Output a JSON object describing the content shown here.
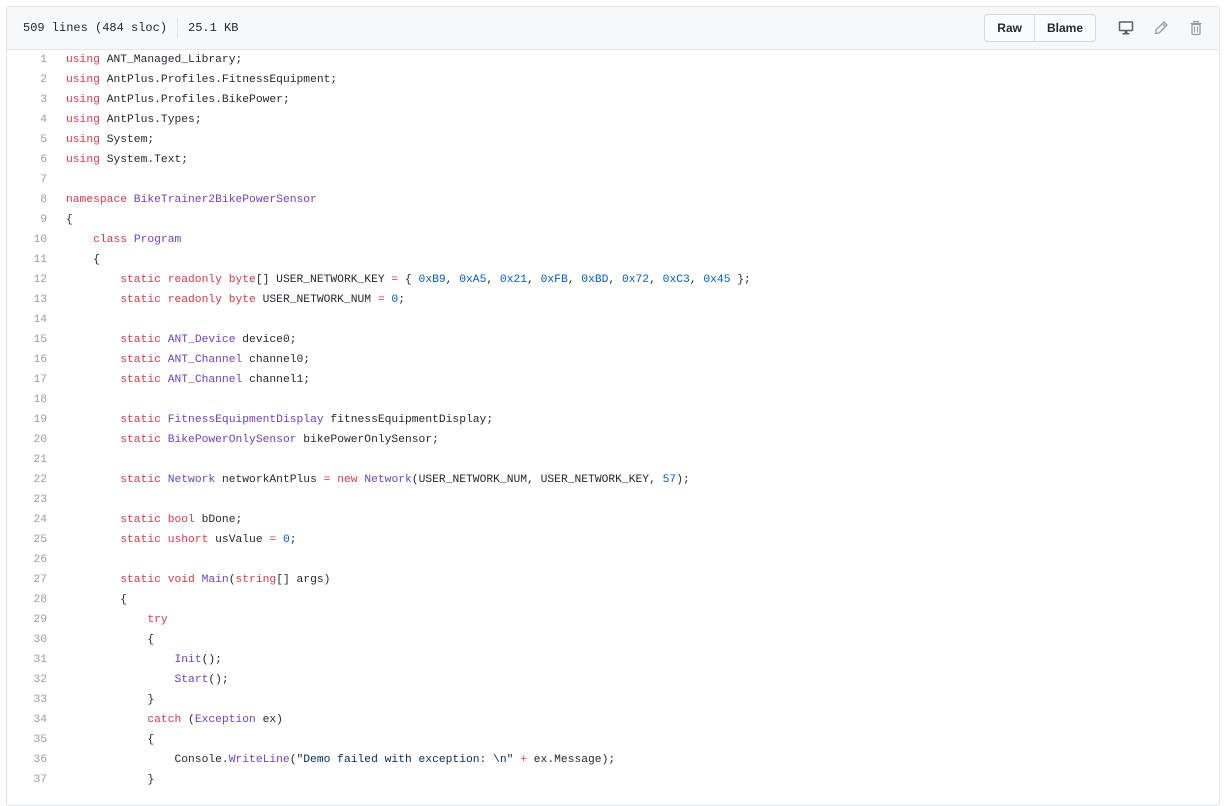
{
  "file_header": {
    "lines_info": "509 lines (484 sloc)",
    "size": "25.1 KB",
    "raw_label": "Raw",
    "blame_label": "Blame"
  },
  "icons": {
    "desktop": "desktop-icon",
    "edit": "pencil-icon",
    "delete": "trash-icon"
  },
  "colors": {
    "keyword": "#d73a49",
    "constant": "#005cc5",
    "entity": "#6f42c1",
    "string": "#032f62",
    "line_number": "#959da5"
  },
  "code": [
    {
      "n": "1",
      "t": [
        [
          "k",
          "using "
        ],
        [
          "",
          "ANT_Managed_Library;"
        ]
      ]
    },
    {
      "n": "2",
      "t": [
        [
          "k",
          "using "
        ],
        [
          "",
          "AntPlus.Profiles.FitnessEquipment;"
        ]
      ]
    },
    {
      "n": "3",
      "t": [
        [
          "k",
          "using "
        ],
        [
          "",
          "AntPlus.Profiles.BikePower;"
        ]
      ]
    },
    {
      "n": "4",
      "t": [
        [
          "k",
          "using "
        ],
        [
          "",
          "AntPlus.Types;"
        ]
      ]
    },
    {
      "n": "5",
      "t": [
        [
          "k",
          "using "
        ],
        [
          "",
          "System;"
        ]
      ]
    },
    {
      "n": "6",
      "t": [
        [
          "k",
          "using "
        ],
        [
          "",
          "System.Text;"
        ]
      ]
    },
    {
      "n": "7",
      "t": []
    },
    {
      "n": "8",
      "t": [
        [
          "k",
          "namespace "
        ],
        [
          "en",
          "BikeTrainer2BikePowerSensor"
        ]
      ]
    },
    {
      "n": "9",
      "t": [
        [
          "",
          "{"
        ]
      ]
    },
    {
      "n": "10",
      "t": [
        [
          "",
          "    "
        ],
        [
          "k",
          "class "
        ],
        [
          "en",
          "Program"
        ]
      ]
    },
    {
      "n": "11",
      "t": [
        [
          "",
          "    {"
        ]
      ]
    },
    {
      "n": "12",
      "t": [
        [
          "",
          "        "
        ],
        [
          "k",
          "static readonly byte"
        ],
        [
          "",
          "[] USER_NETWORK_KEY "
        ],
        [
          "k",
          "="
        ],
        [
          "",
          " { "
        ],
        [
          "c1",
          "0xB9"
        ],
        [
          "",
          ", "
        ],
        [
          "c1",
          "0xA5"
        ],
        [
          "",
          ", "
        ],
        [
          "c1",
          "0x21"
        ],
        [
          "",
          ", "
        ],
        [
          "c1",
          "0xFB"
        ],
        [
          "",
          ", "
        ],
        [
          "c1",
          "0xBD"
        ],
        [
          "",
          ", "
        ],
        [
          "c1",
          "0x72"
        ],
        [
          "",
          ", "
        ],
        [
          "c1",
          "0xC3"
        ],
        [
          "",
          ", "
        ],
        [
          "c1",
          "0x45"
        ],
        [
          "",
          " };"
        ]
      ]
    },
    {
      "n": "13",
      "t": [
        [
          "",
          "        "
        ],
        [
          "k",
          "static readonly byte "
        ],
        [
          "",
          "USER_NETWORK_NUM "
        ],
        [
          "k",
          "="
        ],
        [
          "c1",
          " 0"
        ],
        [
          "",
          ";"
        ]
      ]
    },
    {
      "n": "14",
      "t": []
    },
    {
      "n": "15",
      "t": [
        [
          "",
          "        "
        ],
        [
          "k",
          "static "
        ],
        [
          "en",
          "ANT_Device "
        ],
        [
          "",
          "device0;"
        ]
      ]
    },
    {
      "n": "16",
      "t": [
        [
          "",
          "        "
        ],
        [
          "k",
          "static "
        ],
        [
          "en",
          "ANT_Channel "
        ],
        [
          "",
          "channel0;"
        ]
      ]
    },
    {
      "n": "17",
      "t": [
        [
          "",
          "        "
        ],
        [
          "k",
          "static "
        ],
        [
          "en",
          "ANT_Channel "
        ],
        [
          "",
          "channel1;"
        ]
      ]
    },
    {
      "n": "18",
      "t": []
    },
    {
      "n": "19",
      "t": [
        [
          "",
          "        "
        ],
        [
          "k",
          "static "
        ],
        [
          "en",
          "FitnessEquipmentDisplay "
        ],
        [
          "",
          "fitnessEquipmentDisplay;"
        ]
      ]
    },
    {
      "n": "20",
      "t": [
        [
          "",
          "        "
        ],
        [
          "k",
          "static "
        ],
        [
          "en",
          "BikePowerOnlySensor "
        ],
        [
          "",
          "bikePowerOnlySensor;"
        ]
      ]
    },
    {
      "n": "21",
      "t": []
    },
    {
      "n": "22",
      "t": [
        [
          "",
          "        "
        ],
        [
          "k",
          "static "
        ],
        [
          "en",
          "Network "
        ],
        [
          "",
          "networkAntPlus "
        ],
        [
          "k",
          "= new "
        ],
        [
          "en",
          "Network"
        ],
        [
          "",
          "(USER_NETWORK_NUM, USER_NETWORK_KEY, "
        ],
        [
          "c1",
          "57"
        ],
        [
          "",
          ");"
        ]
      ]
    },
    {
      "n": "23",
      "t": []
    },
    {
      "n": "24",
      "t": [
        [
          "",
          "        "
        ],
        [
          "k",
          "static bool "
        ],
        [
          "",
          "bDone;"
        ]
      ]
    },
    {
      "n": "25",
      "t": [
        [
          "",
          "        "
        ],
        [
          "k",
          "static ushort "
        ],
        [
          "",
          "usValue "
        ],
        [
          "k",
          "="
        ],
        [
          "c1",
          " 0"
        ],
        [
          "",
          ";"
        ]
      ]
    },
    {
      "n": "26",
      "t": []
    },
    {
      "n": "27",
      "t": [
        [
          "",
          "        "
        ],
        [
          "k",
          "static void "
        ],
        [
          "en",
          "Main"
        ],
        [
          "",
          "("
        ],
        [
          "k",
          "string"
        ],
        [
          "",
          "[] args)"
        ]
      ]
    },
    {
      "n": "28",
      "t": [
        [
          "",
          "        {"
        ]
      ]
    },
    {
      "n": "29",
      "t": [
        [
          "",
          "            "
        ],
        [
          "k",
          "try"
        ]
      ]
    },
    {
      "n": "30",
      "t": [
        [
          "",
          "            {"
        ]
      ]
    },
    {
      "n": "31",
      "t": [
        [
          "",
          "                "
        ],
        [
          "en",
          "Init"
        ],
        [
          "",
          "();"
        ]
      ]
    },
    {
      "n": "32",
      "t": [
        [
          "",
          "                "
        ],
        [
          "en",
          "Start"
        ],
        [
          "",
          "();"
        ]
      ]
    },
    {
      "n": "33",
      "t": [
        [
          "",
          "            }"
        ]
      ]
    },
    {
      "n": "34",
      "t": [
        [
          "",
          "            "
        ],
        [
          "k",
          "catch "
        ],
        [
          "",
          "("
        ],
        [
          "en",
          "Exception "
        ],
        [
          "",
          "ex)"
        ]
      ]
    },
    {
      "n": "35",
      "t": [
        [
          "",
          "            {"
        ]
      ]
    },
    {
      "n": "36",
      "t": [
        [
          "",
          "                Console."
        ],
        [
          "en",
          "WriteLine"
        ],
        [
          "",
          "("
        ],
        [
          "s",
          "\"Demo failed with exception: \\n\""
        ],
        [
          "",
          " "
        ],
        [
          "k",
          "+"
        ],
        [
          "",
          " ex.Message);"
        ]
      ]
    },
    {
      "n": "37",
      "t": [
        [
          "",
          "            }"
        ]
      ]
    }
  ]
}
